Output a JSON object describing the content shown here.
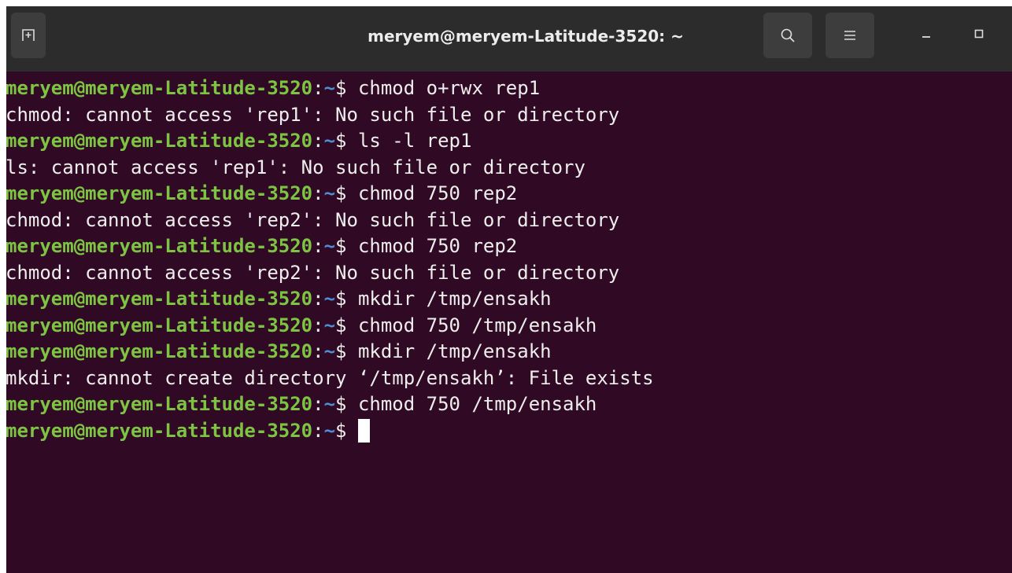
{
  "window": {
    "title": "meryem@meryem-Latitude-3520: ~"
  },
  "icons": {
    "new_tab": "new-tab-icon",
    "search": "search-icon",
    "menu": "hamburger-menu-icon",
    "minimize": "minimize-icon",
    "maximize": "maximize-icon"
  },
  "colors": {
    "terminal_bg": "#300a24",
    "titlebar_bg": "#2c2c2c",
    "prompt_user": "#7ec443",
    "prompt_path": "#4d8fd6",
    "text": "#eeeeec"
  },
  "terminal": {
    "lines": [
      {
        "type": "prompt",
        "user": "meryem@meryem-Latitude-3520",
        "path": "~",
        "command": " chmod o+rwx rep1"
      },
      {
        "type": "output",
        "text": "chmod: cannot access 'rep1': No such file or directory"
      },
      {
        "type": "prompt",
        "user": "meryem@meryem-Latitude-3520",
        "path": "~",
        "command": " ls -l rep1"
      },
      {
        "type": "output",
        "text": "ls: cannot access 'rep1': No such file or directory"
      },
      {
        "type": "prompt",
        "user": "meryem@meryem-Latitude-3520",
        "path": "~",
        "command": " chmod 750 rep2"
      },
      {
        "type": "output",
        "text": "chmod: cannot access 'rep2': No such file or directory"
      },
      {
        "type": "prompt",
        "user": "meryem@meryem-Latitude-3520",
        "path": "~",
        "command": " chmod 750 rep2"
      },
      {
        "type": "output",
        "text": "chmod: cannot access 'rep2': No such file or directory"
      },
      {
        "type": "prompt",
        "user": "meryem@meryem-Latitude-3520",
        "path": "~",
        "command": " mkdir /tmp/ensakh"
      },
      {
        "type": "prompt",
        "user": "meryem@meryem-Latitude-3520",
        "path": "~",
        "command": " chmod 750 /tmp/ensakh"
      },
      {
        "type": "prompt",
        "user": "meryem@meryem-Latitude-3520",
        "path": "~",
        "command": " mkdir /tmp/ensakh"
      },
      {
        "type": "output",
        "text": "mkdir: cannot create directory ‘/tmp/ensakh’: File exists"
      },
      {
        "type": "prompt",
        "user": "meryem@meryem-Latitude-3520",
        "path": "~",
        "command": " chmod 750 /tmp/ensakh"
      },
      {
        "type": "prompt",
        "user": "meryem@meryem-Latitude-3520",
        "path": "~",
        "command": " ",
        "cursor": true
      }
    ]
  }
}
